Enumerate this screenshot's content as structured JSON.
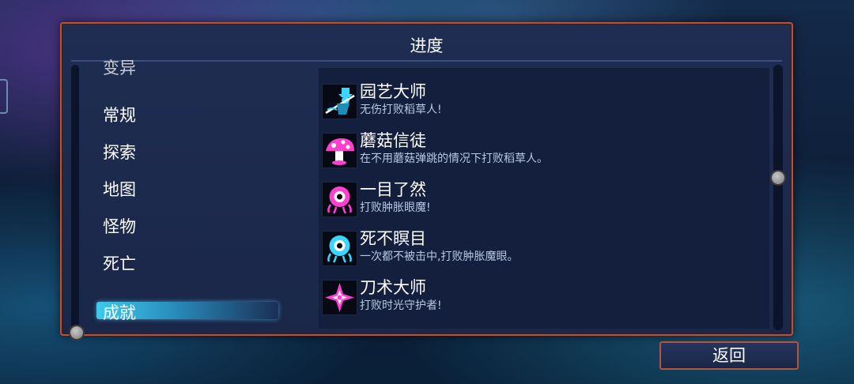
{
  "panel": {
    "title": "进度"
  },
  "categories": [
    {
      "label": "变异"
    },
    {
      "label": "常规"
    },
    {
      "label": "探索"
    },
    {
      "label": "地图"
    },
    {
      "label": "怪物"
    },
    {
      "label": "死亡"
    },
    {
      "label": "成就"
    }
  ],
  "selected_category": "成就",
  "achievements": [
    {
      "name": "园艺大师",
      "desc": "无伤打败稻草人!",
      "icon": "scarecrow-icon",
      "color": "#3bd6ff"
    },
    {
      "name": "蘑菇信徒",
      "desc": "在不用蘑菇弹跳的情况下打败稻草人。",
      "icon": "mushroom-icon",
      "color": "#ff3fd0"
    },
    {
      "name": "一目了然",
      "desc": "打败肿胀眼魔!",
      "icon": "eye-monster-icon",
      "color": "#ff3fd0"
    },
    {
      "name": "死不瞑目",
      "desc": "一次都不被击中,打败肿胀魔眼。",
      "icon": "eye-monster-icon",
      "color": "#3bd6ff"
    },
    {
      "name": "刀术大师",
      "desc": "打败时光守护者!",
      "icon": "shuriken-icon",
      "color": "#ff3fd0"
    }
  ],
  "back_button": {
    "label": "返回"
  }
}
